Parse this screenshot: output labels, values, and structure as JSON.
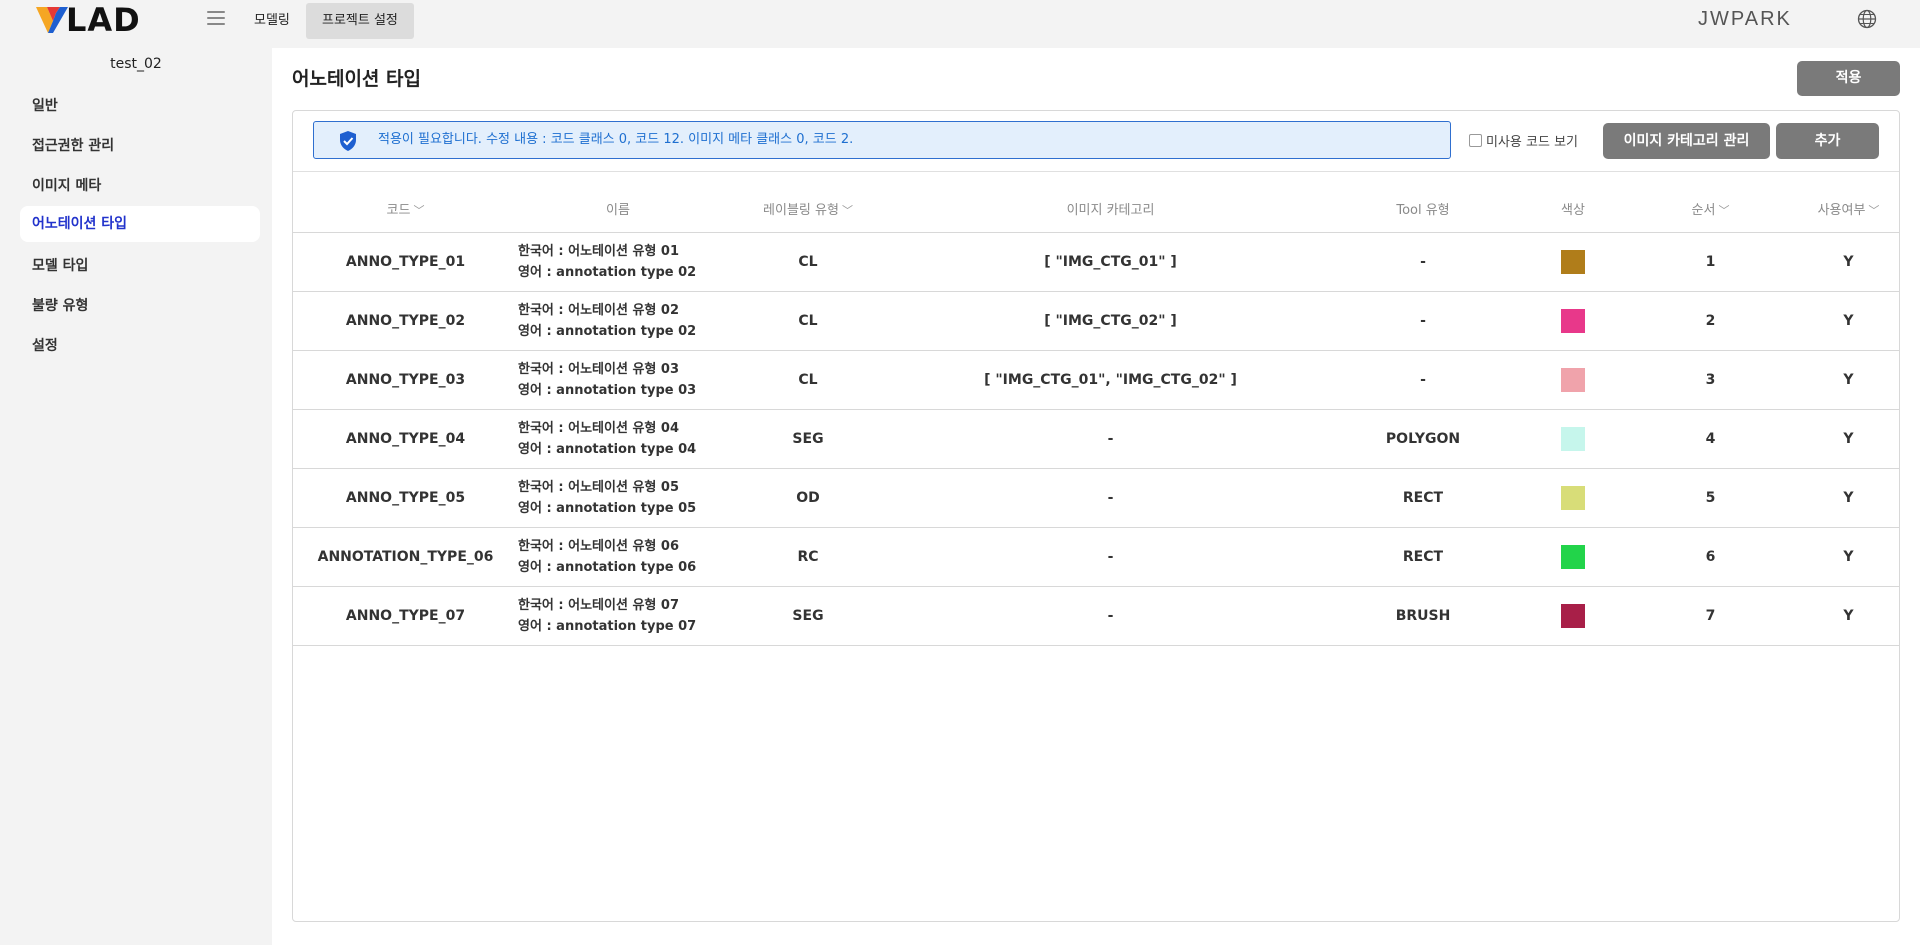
{
  "topbar": {
    "logo_text": "LAD",
    "menu_icon": "hamburger-icon",
    "nav": [
      {
        "label": "모델링"
      },
      {
        "label": "프로젝트 설정"
      }
    ],
    "username": "JWPARK",
    "globe_icon": "globe-icon"
  },
  "sidebar": {
    "project_name": "test_02",
    "items": [
      {
        "label": "일반"
      },
      {
        "label": "접근권한 관리"
      },
      {
        "label": "이미지 메타"
      },
      {
        "label": "어노테이션 타입"
      },
      {
        "label": "모델 타입"
      },
      {
        "label": "불량 유형"
      },
      {
        "label": "설정"
      }
    ],
    "active_index": 3
  },
  "main": {
    "title": "어노테이션 타입",
    "apply_label": "적용",
    "notice": "적용이 필요합니다. 수정 내용 : 코드 클래스 0, 코드 12. 이미지 메타 클래스 0, 코드 2.",
    "unused_label": "미사용 코드 보기",
    "category_btn_label": "이미지 카테고리 관리",
    "add_btn_label": "추가",
    "columns": [
      "코드",
      "이름",
      "레이블링 유형",
      "이미지 카테고리",
      "Tool 유형",
      "색상",
      "순서",
      "사용여부"
    ],
    "rows": [
      {
        "code": "ANNO_TYPE_01",
        "name_ko": "한국어 : 어노테이션 유형 01",
        "name_en": "영어 : annotation type 02",
        "label_type": "CL",
        "category": "[ \"IMG_CTG_01\" ]",
        "tool": "-",
        "color": "#b07d1a",
        "order": "1",
        "use": "Y"
      },
      {
        "code": "ANNO_TYPE_02",
        "name_ko": "한국어 : 어노테이션 유형 02",
        "name_en": "영어 : annotation type 02",
        "label_type": "CL",
        "category": "[ \"IMG_CTG_02\" ]",
        "tool": "-",
        "color": "#e8388a",
        "order": "2",
        "use": "Y"
      },
      {
        "code": "ANNO_TYPE_03",
        "name_ko": "한국어 : 어노테이션 유형 03",
        "name_en": "영어 : annotation type 03",
        "label_type": "CL",
        "category": "[ \"IMG_CTG_01\", \"IMG_CTG_02\" ]",
        "tool": "-",
        "color": "#f0a3ab",
        "order": "3",
        "use": "Y"
      },
      {
        "code": "ANNO_TYPE_04",
        "name_ko": "한국어 : 어노테이션 유형 04",
        "name_en": "영어 : annotation type 04",
        "label_type": "SEG",
        "category": "-",
        "tool": "POLYGON",
        "color": "#c6f6ec",
        "order": "4",
        "use": "Y"
      },
      {
        "code": "ANNO_TYPE_05",
        "name_ko": "한국어 : 어노테이션 유형 05",
        "name_en": "영어 : annotation type 05",
        "label_type": "OD",
        "category": "-",
        "tool": "RECT",
        "color": "#d8dd78",
        "order": "5",
        "use": "Y"
      },
      {
        "code": "ANNOTATION_TYPE_06",
        "name_ko": "한국어 : 어노테이션 유형 06",
        "name_en": "영어 : annotation type 06",
        "label_type": "RC",
        "category": "-",
        "tool": "RECT",
        "color": "#22d44a",
        "order": "6",
        "use": "Y"
      },
      {
        "code": "ANNO_TYPE_07",
        "name_ko": "한국어 : 어노테이션 유형 07",
        "name_en": "영어 : annotation type 07",
        "label_type": "SEG",
        "category": "-",
        "tool": "BRUSH",
        "color": "#a81f48",
        "order": "7",
        "use": "Y"
      }
    ]
  }
}
